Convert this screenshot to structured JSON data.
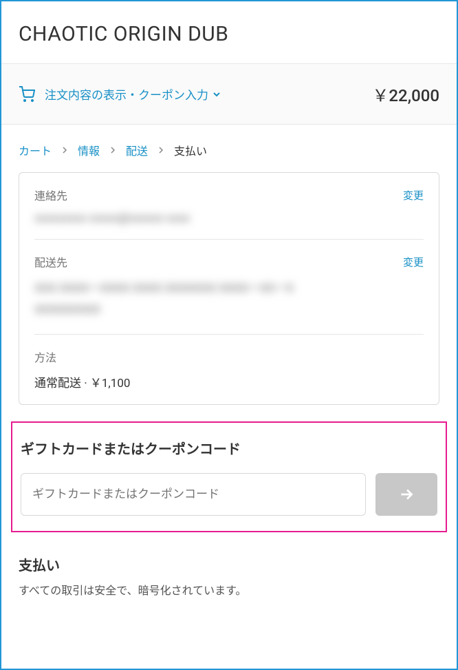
{
  "header": {
    "brand_title": "CHAOTIC ORIGIN DUB"
  },
  "order_summary": {
    "toggle_text": "注文内容の表示・クーポン入力",
    "total": "￥22,000"
  },
  "breadcrumbs": {
    "cart": "カート",
    "info": "情報",
    "shipping": "配送",
    "payment": "支払い"
  },
  "review": {
    "contact_label": "連絡先",
    "contact_value": "xxxxxxxxx xxxxx@xxxxxx xxxx",
    "shipping_label": "配送先",
    "shipping_value_line1": "XXX XXXXーXXXX XXXX XXXXXXX XXXXーXXーX",
    "shipping_value_line2": "XXXXXXXXX",
    "method_label": "方法",
    "method_value": "通常配送 · ￥1,100",
    "change_link": "変更"
  },
  "coupon": {
    "title": "ギフトカードまたはクーポンコード",
    "placeholder": "ギフトカードまたはクーポンコード"
  },
  "payment": {
    "title": "支払い",
    "subtitle": "すべての取引は安全で、暗号化されています。"
  }
}
